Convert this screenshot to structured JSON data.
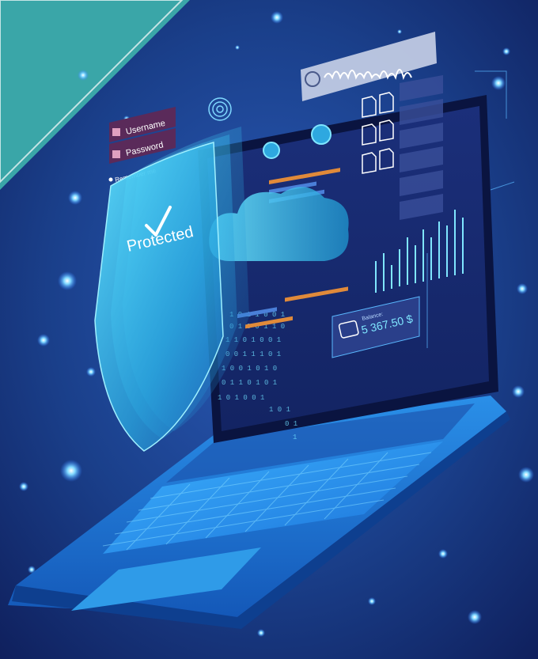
{
  "login": {
    "username_label": "Username",
    "password_label": "Password",
    "remember_label": "Remember me"
  },
  "shield": {
    "status_text": "Protected"
  },
  "wallet": {
    "balance_label": "Balance:",
    "balance_value": "5 367.50 $"
  },
  "colors": {
    "background_top": "#1a3f8a",
    "background_bottom": "#0f1f5c",
    "teal_corner": "#3aa6a8",
    "shield": "#3fd0f0",
    "screen_glow": "#2ed3ff",
    "accent_orange": "#e08a3a"
  },
  "icons": {
    "fingerprint": "fingerprint-icon",
    "user": "user-icon",
    "lock": "lock-icon",
    "checkmark": "checkmark-icon",
    "cloud": "cloud-icon",
    "wallet": "wallet-icon",
    "document": "document-icon",
    "waveform": "audio-waveform-icon"
  }
}
